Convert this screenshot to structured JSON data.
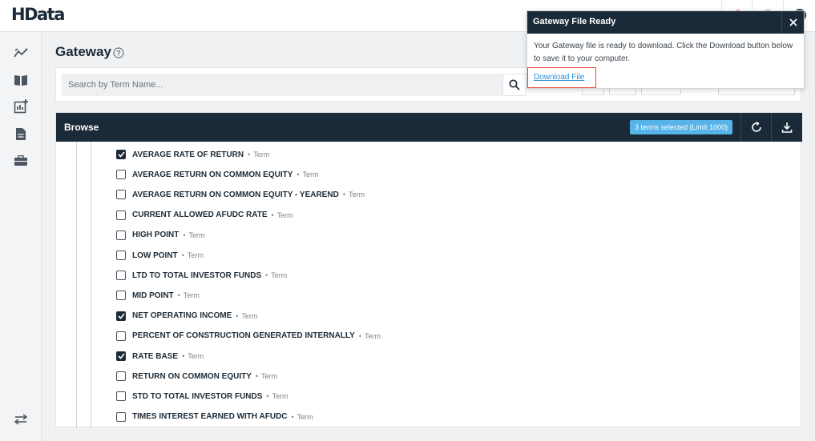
{
  "app": {
    "logo": "HData"
  },
  "page": {
    "title": "Gateway"
  },
  "search": {
    "placeholder": "Search by Term Name..."
  },
  "browse": {
    "title": "Browse",
    "selection_badge": "3 terms selected (Limit 1000)",
    "terms": [
      {
        "name": "AVERAGE RATE OF RETURN",
        "type": "Term",
        "checked": true
      },
      {
        "name": "AVERAGE RETURN ON COMMON EQUITY",
        "type": "Term",
        "checked": false
      },
      {
        "name": "AVERAGE RETURN ON COMMON EQUITY - YEAREND",
        "type": "Term",
        "checked": false
      },
      {
        "name": "CURRENT ALLOWED AFUDC RATE",
        "type": "Term",
        "checked": false
      },
      {
        "name": "HIGH POINT",
        "type": "Term",
        "checked": false
      },
      {
        "name": "LOW POINT",
        "type": "Term",
        "checked": false
      },
      {
        "name": "LTD TO TOTAL INVESTOR FUNDS",
        "type": "Term",
        "checked": false
      },
      {
        "name": "MID POINT",
        "type": "Term",
        "checked": false
      },
      {
        "name": "NET OPERATING INCOME",
        "type": "Term",
        "checked": true
      },
      {
        "name": "PERCENT OF CONSTRUCTION GENERATED INTERNALLY",
        "type": "Term",
        "checked": false
      },
      {
        "name": "RATE BASE",
        "type": "Term",
        "checked": true
      },
      {
        "name": "RETURN ON COMMON EQUITY",
        "type": "Term",
        "checked": false
      },
      {
        "name": "STD TO TOTAL INVESTOR FUNDS",
        "type": "Term",
        "checked": false
      },
      {
        "name": "TIMES INTEREST EARNED WITH AFUDC",
        "type": "Term",
        "checked": false
      }
    ]
  },
  "popup": {
    "title": "Gateway File Ready",
    "message": "Your Gateway file is ready to download. Click the Download button below to save it to your computer.",
    "link_label": "Download File"
  },
  "colors": {
    "header_bg": "#1b2a38",
    "badge": "#56b4e9",
    "highlight": "#e8473b",
    "link": "#2f8fd6"
  }
}
